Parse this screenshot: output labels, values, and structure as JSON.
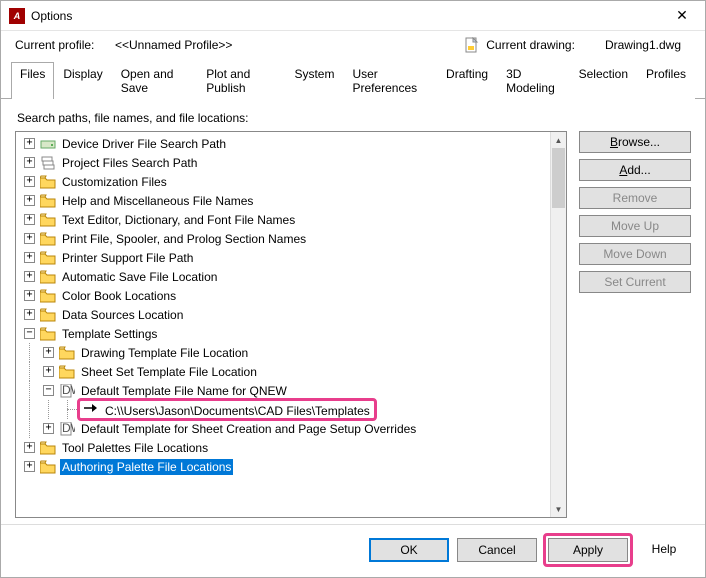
{
  "window": {
    "title": "Options"
  },
  "header": {
    "currentProfileLabel": "Current profile:",
    "currentProfileValue": "<<Unnamed Profile>>",
    "currentDrawingLabel": "Current drawing:",
    "currentDrawingValue": "Drawing1.dwg"
  },
  "tabs": [
    {
      "label": "Files",
      "active": true
    },
    {
      "label": "Display",
      "active": false
    },
    {
      "label": "Open and Save",
      "active": false
    },
    {
      "label": "Plot and Publish",
      "active": false
    },
    {
      "label": "System",
      "active": false
    },
    {
      "label": "User Preferences",
      "active": false
    },
    {
      "label": "Drafting",
      "active": false
    },
    {
      "label": "3D Modeling",
      "active": false
    },
    {
      "label": "Selection",
      "active": false
    },
    {
      "label": "Profiles",
      "active": false
    }
  ],
  "searchLabel": "Search paths, file names, and file locations:",
  "tree": [
    {
      "depth": 0,
      "icon": "drive",
      "label": "Device Driver File Search Path",
      "exp": "plus"
    },
    {
      "depth": 0,
      "icon": "stack",
      "label": "Project Files Search Path",
      "exp": "plus"
    },
    {
      "depth": 0,
      "icon": "folder",
      "label": "Customization Files",
      "exp": "plus"
    },
    {
      "depth": 0,
      "icon": "folder",
      "label": "Help and Miscellaneous File Names",
      "exp": "plus"
    },
    {
      "depth": 0,
      "icon": "folder",
      "label": "Text Editor, Dictionary, and Font File Names",
      "exp": "plus"
    },
    {
      "depth": 0,
      "icon": "folder",
      "label": "Print File, Spooler, and Prolog Section Names",
      "exp": "plus"
    },
    {
      "depth": 0,
      "icon": "folder",
      "label": "Printer Support File Path",
      "exp": "plus"
    },
    {
      "depth": 0,
      "icon": "folder-open",
      "label": "Automatic Save File Location",
      "exp": "plus"
    },
    {
      "depth": 0,
      "icon": "folder-open",
      "label": "Color Book Locations",
      "exp": "plus"
    },
    {
      "depth": 0,
      "icon": "folder-open",
      "label": "Data Sources Location",
      "exp": "plus"
    },
    {
      "depth": 0,
      "icon": "folder",
      "label": "Template Settings",
      "exp": "minus"
    },
    {
      "depth": 1,
      "icon": "folder-open",
      "label": "Drawing Template File Location",
      "exp": "plus"
    },
    {
      "depth": 1,
      "icon": "folder-open",
      "label": "Sheet Set Template File Location",
      "exp": "plus"
    },
    {
      "depth": 1,
      "icon": "dwg",
      "label": "Default Template File Name for QNEW",
      "exp": "minus"
    },
    {
      "depth": 2,
      "icon": "arrow",
      "label": "C:\\\\Users\\Jason\\Documents\\CAD Files\\Templates",
      "exp": "none",
      "highlight": true
    },
    {
      "depth": 1,
      "icon": "dwg",
      "label": "Default Template for Sheet Creation and Page Setup Overrides",
      "exp": "plus"
    },
    {
      "depth": 0,
      "icon": "folder-open",
      "label": "Tool Palettes File Locations",
      "exp": "plus"
    },
    {
      "depth": 0,
      "icon": "folder-open",
      "label": "Authoring Palette File Locations",
      "exp": "plus",
      "selected": true
    }
  ],
  "sideButtons": [
    {
      "label": "Browse...",
      "underline": "B",
      "disabled": false
    },
    {
      "label": "Add...",
      "underline": "A",
      "disabled": false
    },
    {
      "label": "Remove",
      "underline": "R",
      "disabled": true
    },
    {
      "label": "Move Up",
      "underline": "M",
      "disabled": true
    },
    {
      "label": "Move Down",
      "underline": "M",
      "disabled": true
    },
    {
      "label": "Set Current",
      "underline": "S",
      "disabled": true
    }
  ],
  "footer": {
    "ok": "OK",
    "cancel": "Cancel",
    "apply": "Apply",
    "help": "Help"
  }
}
